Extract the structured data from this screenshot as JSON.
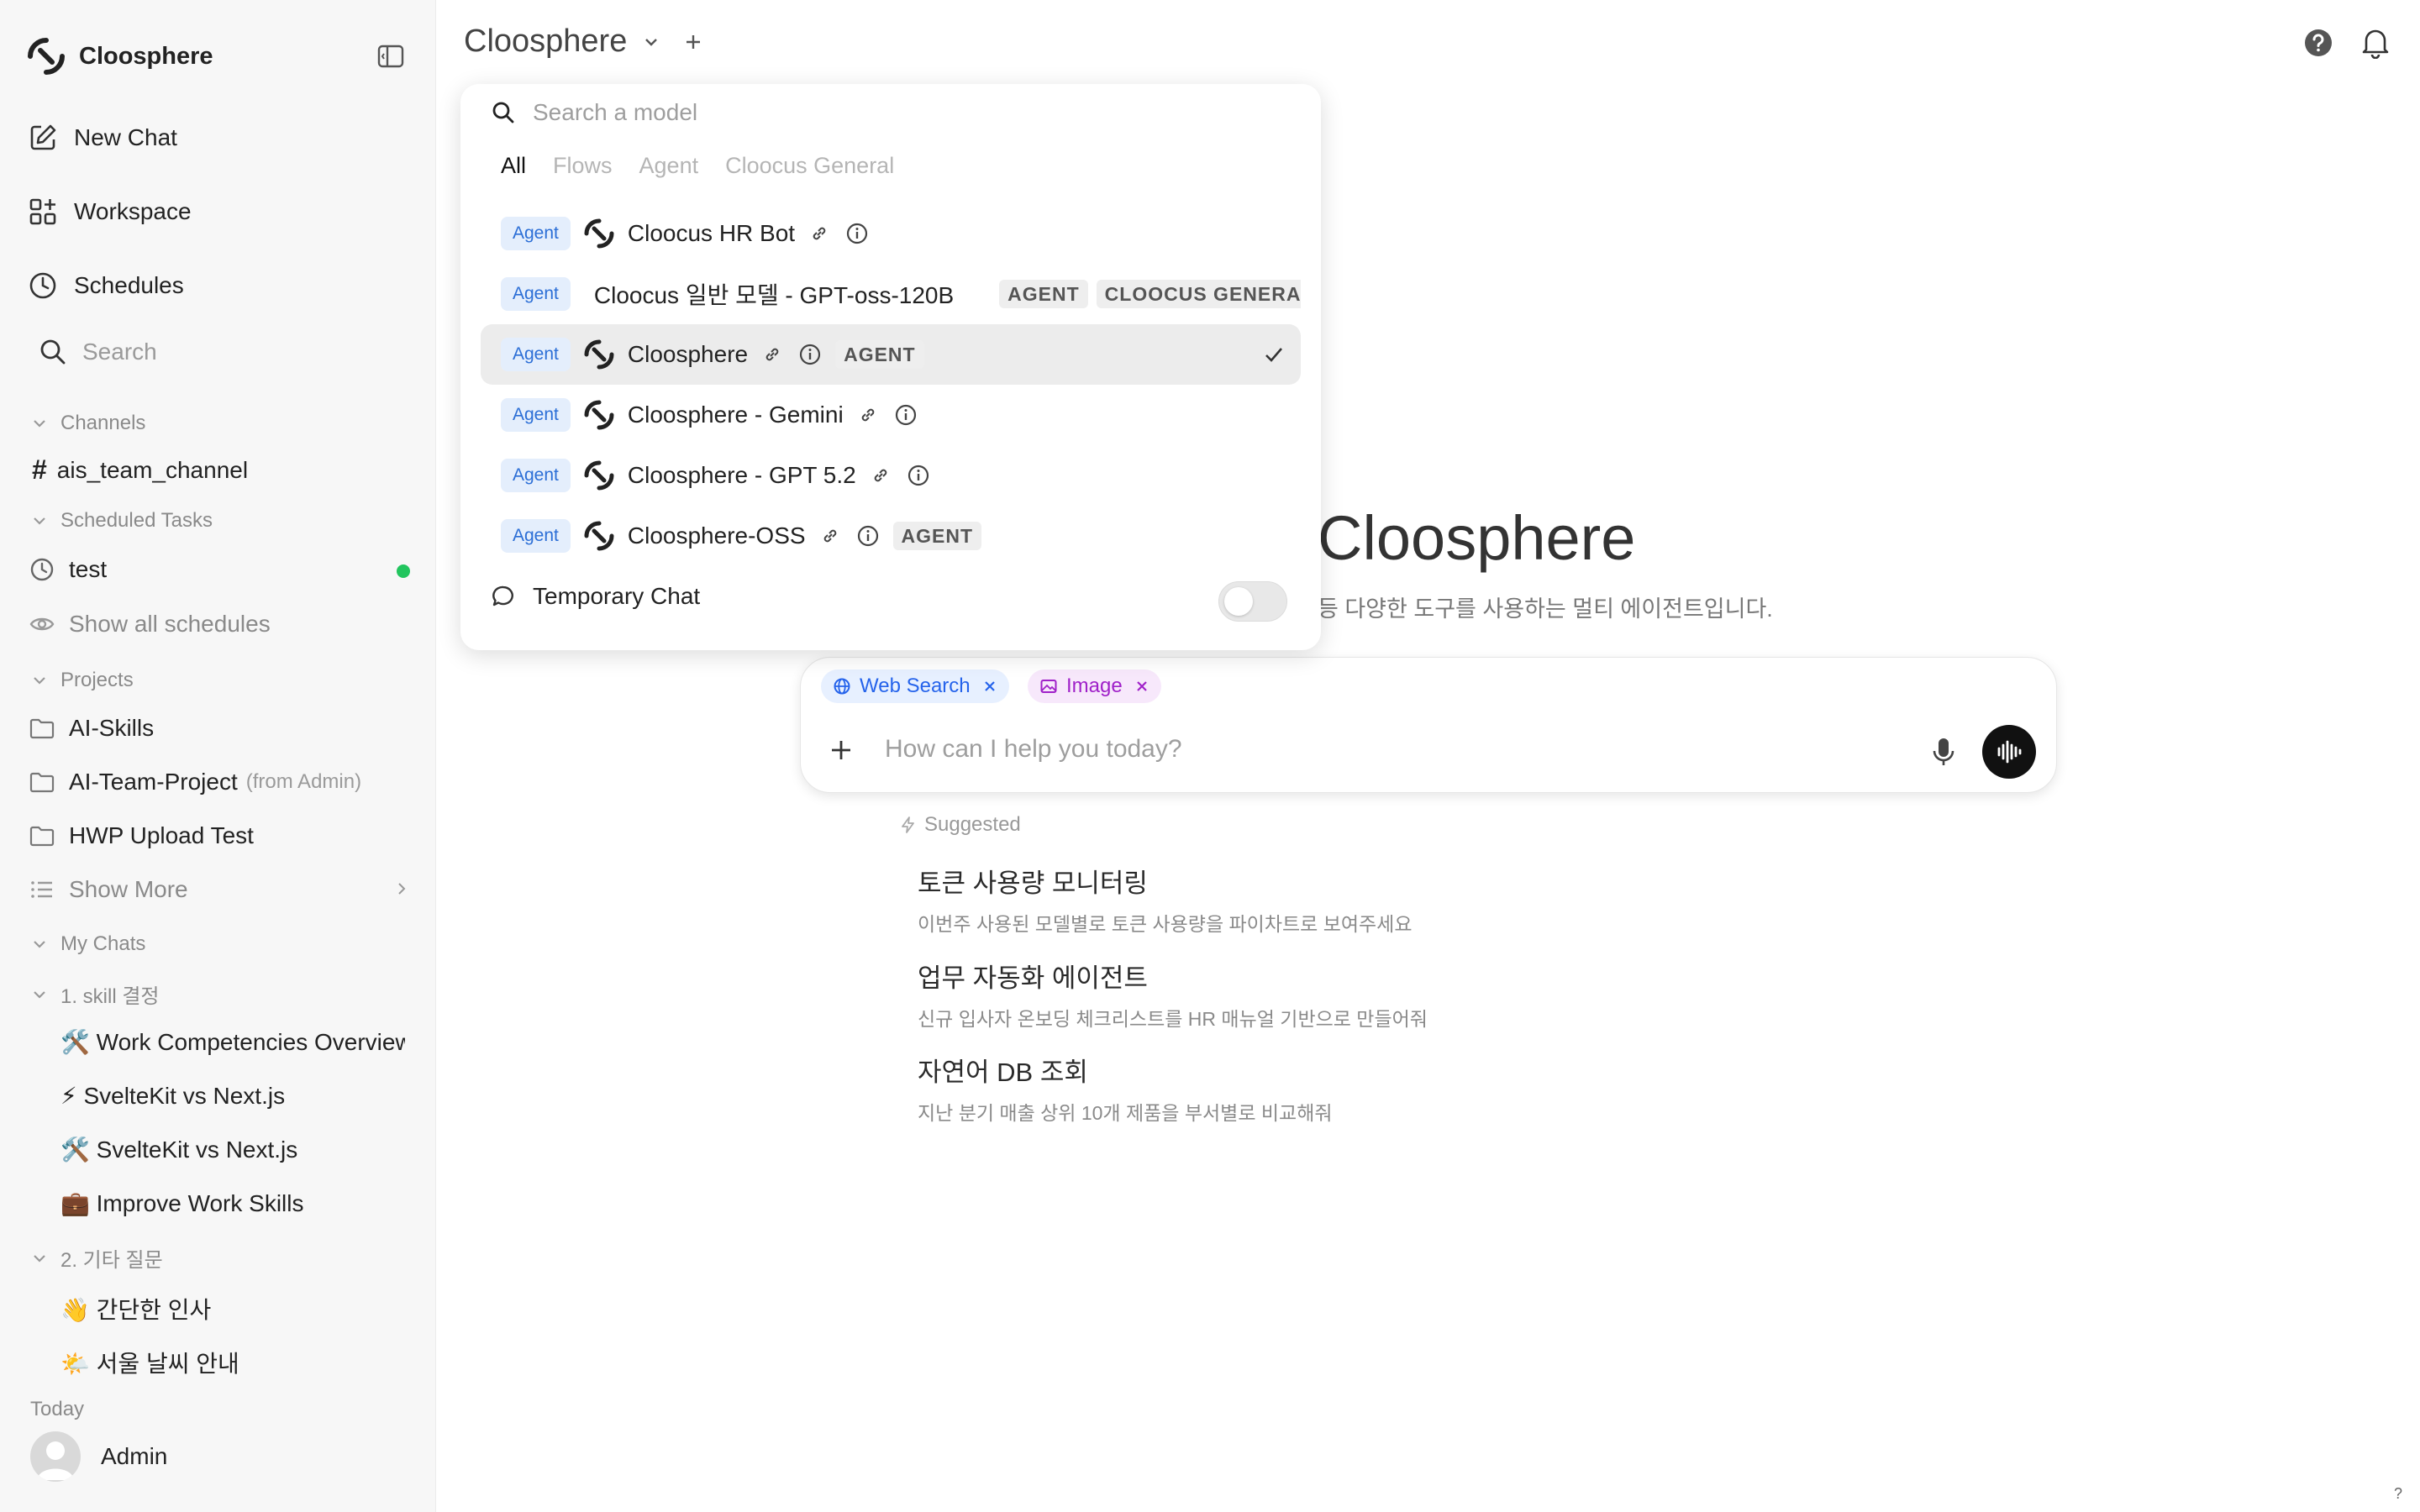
{
  "sidebar": {
    "brand": "Cloosphere",
    "nav": {
      "new_chat": "New Chat",
      "workspace": "Workspace",
      "schedules": "Schedules",
      "search_placeholder": "Search"
    },
    "channels": {
      "header": "Channels",
      "items": [
        "ais_team_channel"
      ]
    },
    "scheduled_tasks": {
      "header": "Scheduled Tasks",
      "items": [
        "test"
      ],
      "show_all": "Show all schedules"
    },
    "projects": {
      "header": "Projects",
      "items": [
        {
          "label": "AI-Skills",
          "from": ""
        },
        {
          "label": "AI-Team-Project",
          "from": "(from Admin)"
        },
        {
          "label": "HWP Upload Test",
          "from": ""
        }
      ],
      "show_more": "Show More"
    },
    "my_chats": {
      "header": "My Chats",
      "folders": [
        {
          "name": "1. skill 결정",
          "chats": [
            "🛠️ Work Competencies Overview",
            "⚡ SvelteKit vs Next.js",
            "🛠️ SvelteKit vs Next.js",
            "💼 Improve Work Skills"
          ]
        },
        {
          "name": "2. 기타 질문",
          "chats": [
            "👋 간단한 인사",
            "🌤️ 서울 날씨 안내"
          ]
        }
      ],
      "today": "Today"
    },
    "user": {
      "name": "Admin"
    }
  },
  "topbar": {
    "model_title": "Cloosphere"
  },
  "main": {
    "hero_title": "Cloosphere",
    "hero_subtitle": "등 다양한 도구를 사용하는 멀티 에이전트입니다.",
    "chips": {
      "web": "Web Search",
      "image": "Image"
    },
    "input_placeholder": "How can I help you today?",
    "suggested_header": "Suggested",
    "suggestions": [
      {
        "title": "토큰 사용량 모니터링",
        "desc": "이번주 사용된 모델별로 토큰 사용량을 파이차트로 보여주세요"
      },
      {
        "title": "업무 자동화 에이전트",
        "desc": "신규 입사자 온보딩 체크리스트를 HR 매뉴얼 기반으로 만들어줘"
      },
      {
        "title": "자연어 DB 조회",
        "desc": "지난 분기 매출 상위 10개 제품을 부서별로 비교해줘"
      }
    ]
  },
  "dropdown": {
    "search_placeholder": "Search a model",
    "tabs": [
      "All",
      "Flows",
      "Agent",
      "Cloocus General"
    ],
    "active_tab": "All",
    "agent_label": "Agent",
    "models": [
      {
        "name": "Cloocus HR Bot",
        "tags": []
      },
      {
        "name": "Cloocus 일반 모델 - GPT-oss-120B",
        "tags": [
          "AGENT",
          "CLOOCUS GENERAL"
        ]
      },
      {
        "name": "Cloosphere",
        "tags": [
          "AGENT"
        ]
      },
      {
        "name": "Cloosphere - Gemini",
        "tags": []
      },
      {
        "name": "Cloosphere - GPT 5.2",
        "tags": []
      },
      {
        "name": "Cloosphere-OSS",
        "tags": [
          "AGENT"
        ]
      }
    ],
    "temporary_chat": "Temporary Chat"
  },
  "help_corner": "?"
}
